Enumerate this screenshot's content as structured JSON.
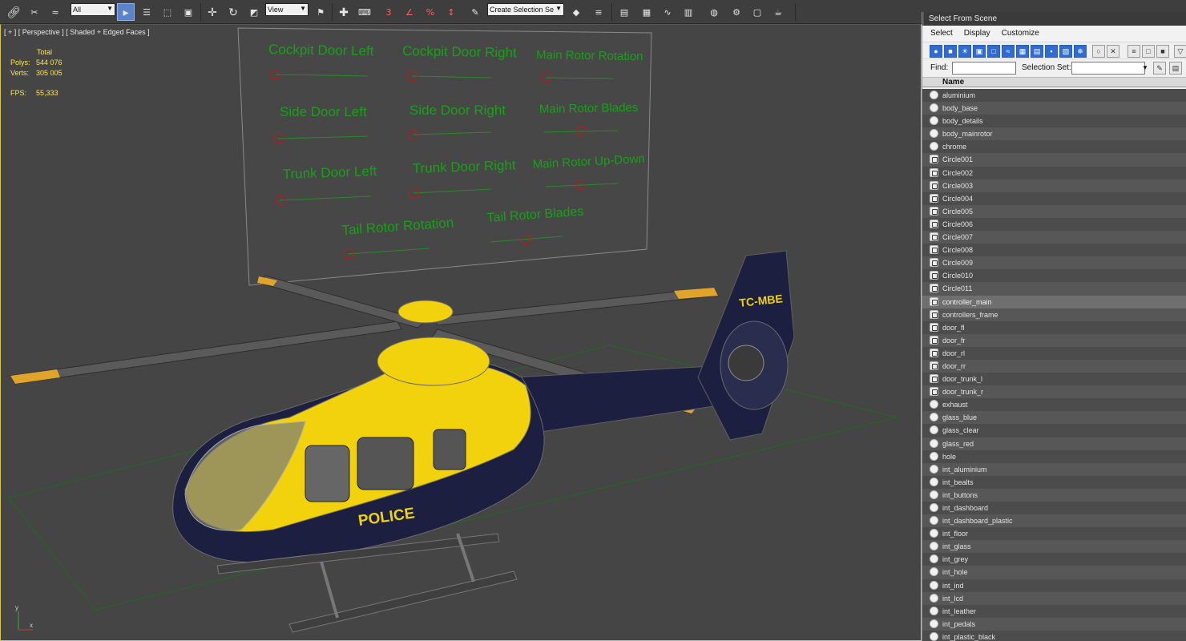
{
  "toolbar": {
    "selection_filter": "All",
    "reference_coord": "View",
    "named_selection_placeholder": "Create Selection Se",
    "snap_value": "3",
    "icons": [
      "link-icon",
      "unlink-icon",
      "bind-space-warp-icon",
      "filter-combo",
      "select-object-icon",
      "select-by-name-icon",
      "rect-selection-icon",
      "window-crossing-icon",
      "move-icon",
      "rotate-icon",
      "scale-icon",
      "coord-system-combo",
      "use-pivot-icon",
      "select-manipulate-icon",
      "keyboard-shortcut-icon",
      "snap-3d-icon",
      "angle-snap-icon",
      "percent-snap-icon",
      "spinner-snap-icon",
      "edit-named-selection-icon",
      "named-selection-combo",
      "mirror-icon",
      "align-icon",
      "layer-manager-icon",
      "graphite-ribbon-icon",
      "curve-editor-icon",
      "schematic-view-icon",
      "material-editor-icon",
      "render-setup-icon",
      "rendered-frame-icon",
      "render-production-icon",
      "teapot-icon"
    ]
  },
  "viewport": {
    "label": "[ + ] [ Perspective ] [ Shaded + Edged Faces ]",
    "stats": {
      "header": "Total",
      "polys_label": "Polys:",
      "polys_value": "544 076",
      "verts_label": "Verts:",
      "verts_value": "305 005",
      "fps_label": "FPS:",
      "fps_value": "55,333"
    },
    "controller_labels": [
      "Cockpit Door Left",
      "Cockpit Door Right",
      "Main Rotor Rotation",
      "Side Door Left",
      "Side  Door Right",
      "Main Rotor Blades",
      "Trunk Door Left",
      "Trunk Door Right",
      "Main Rotor Up-Down",
      "Tail Rotor Rotation",
      "Tail  Rotor Blades"
    ],
    "tail_registration": "TC-MBE",
    "fuselage_text": "POLICE",
    "axis_y": "y",
    "axis_x": "x",
    "colors": {
      "background": "#454545",
      "grid": "#1d6b1d",
      "controller_text": "#18a018",
      "body_yellow": "#f1d20d",
      "body_navy": "#1c1f3f",
      "wire": "#5f5f5f"
    }
  },
  "dialog": {
    "title": "Select From Scene",
    "menu": [
      "Select",
      "Display",
      "Customize"
    ],
    "find_label": "Find:",
    "selection_set_label": "Selection Set:",
    "column_name": "Name",
    "items": [
      {
        "name": "aluminium",
        "icon": "material"
      },
      {
        "name": "body_base",
        "icon": "material"
      },
      {
        "name": "body_details",
        "icon": "material"
      },
      {
        "name": "body_mainrotor",
        "icon": "material"
      },
      {
        "name": "chrome",
        "icon": "material"
      },
      {
        "name": "Circle001",
        "icon": "shape"
      },
      {
        "name": "Circle002",
        "icon": "shape"
      },
      {
        "name": "Circle003",
        "icon": "shape"
      },
      {
        "name": "Circle004",
        "icon": "shape"
      },
      {
        "name": "Circle005",
        "icon": "shape"
      },
      {
        "name": "Circle006",
        "icon": "shape"
      },
      {
        "name": "Circle007",
        "icon": "shape"
      },
      {
        "name": "Circle008",
        "icon": "shape"
      },
      {
        "name": "Circle009",
        "icon": "shape"
      },
      {
        "name": "Circle010",
        "icon": "shape"
      },
      {
        "name": "Circle011",
        "icon": "shape"
      },
      {
        "name": "controller_main",
        "icon": "shape",
        "selected": true
      },
      {
        "name": "controllers_frame",
        "icon": "shape"
      },
      {
        "name": "door_fl",
        "icon": "shape"
      },
      {
        "name": "door_fr",
        "icon": "shape"
      },
      {
        "name": "door_rl",
        "icon": "shape"
      },
      {
        "name": "door_rr",
        "icon": "shape"
      },
      {
        "name": "door_trunk_l",
        "icon": "shape"
      },
      {
        "name": "door_trunk_r",
        "icon": "shape"
      },
      {
        "name": "exhaust",
        "icon": "material"
      },
      {
        "name": "glass_blue",
        "icon": "material"
      },
      {
        "name": "glass_clear",
        "icon": "material"
      },
      {
        "name": "glass_red",
        "icon": "material"
      },
      {
        "name": "hole",
        "icon": "material"
      },
      {
        "name": "int_aluminium",
        "icon": "material"
      },
      {
        "name": "int_bealts",
        "icon": "material"
      },
      {
        "name": "int_buttons",
        "icon": "material"
      },
      {
        "name": "int_dashboard",
        "icon": "material"
      },
      {
        "name": "int_dashboard_plastic",
        "icon": "material"
      },
      {
        "name": "int_floor",
        "icon": "material"
      },
      {
        "name": "int_glass",
        "icon": "material"
      },
      {
        "name": "int_grey",
        "icon": "material"
      },
      {
        "name": "int_hole",
        "icon": "material"
      },
      {
        "name": "int_ind",
        "icon": "material"
      },
      {
        "name": "int_lcd",
        "icon": "material"
      },
      {
        "name": "int_leather",
        "icon": "material"
      },
      {
        "name": "int_pedals",
        "icon": "material"
      },
      {
        "name": "int_plastic_black",
        "icon": "material"
      }
    ]
  }
}
